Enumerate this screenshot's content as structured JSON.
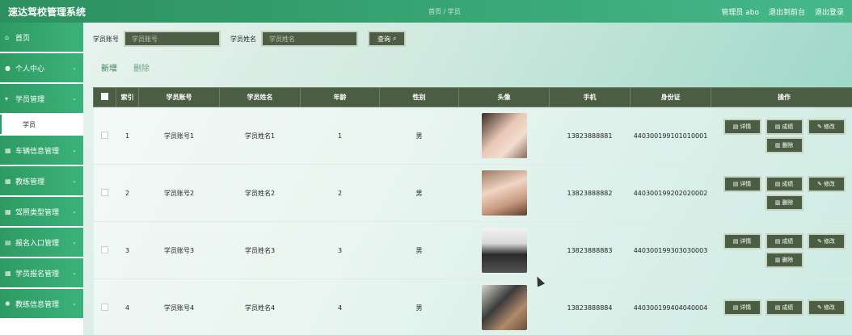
{
  "header": {
    "app_title": "速达驾校管理系统",
    "breadcrumb": "首页 / 学员",
    "admin_label": "管理员 abo",
    "to_front": "退出到前台",
    "logout": "退出登录"
  },
  "sidebar": {
    "items": [
      {
        "label": "首页",
        "icon": "home-icon"
      },
      {
        "label": "个人中心",
        "icon": "user-icon"
      },
      {
        "label": "学员管理",
        "icon": "user-list-icon"
      },
      {
        "label": "车辆信息管理",
        "icon": "grid-icon"
      },
      {
        "label": "教练管理",
        "icon": "grid-icon"
      },
      {
        "label": "驾照类型管理",
        "icon": "grid-icon"
      },
      {
        "label": "报名入口管理",
        "icon": "doc-icon"
      },
      {
        "label": "学员报名管理",
        "icon": "grid-icon"
      },
      {
        "label": "教练信息管理",
        "icon": "gear-icon"
      }
    ],
    "sub_item": "学员"
  },
  "search": {
    "account_label": "学员账号",
    "account_placeholder": "学员账号",
    "name_label": "学员姓名",
    "name_placeholder": "学员姓名",
    "query_button": "查询"
  },
  "actions": {
    "add": "新增",
    "delete": "删除"
  },
  "table": {
    "headers": [
      "",
      "索引",
      "学员账号",
      "学员姓名",
      "年龄",
      "性别",
      "头像",
      "手机",
      "身份证",
      "操作"
    ],
    "rows": [
      {
        "index": "1",
        "account": "学员账号1",
        "name": "学员姓名1",
        "age": "1",
        "gender": "男",
        "phone": "13823888881",
        "id_card": "440300199101010001"
      },
      {
        "index": "2",
        "account": "学员账号2",
        "name": "学员姓名2",
        "age": "2",
        "gender": "男",
        "phone": "13823888882",
        "id_card": "440300199202020002"
      },
      {
        "index": "3",
        "account": "学员账号3",
        "name": "学员姓名3",
        "age": "3",
        "gender": "男",
        "phone": "13823888883",
        "id_card": "440300199303030003"
      },
      {
        "index": "4",
        "account": "学员账号4",
        "name": "学员姓名4",
        "age": "4",
        "gender": "男",
        "phone": "13823888884",
        "id_card": "440300199404040004"
      }
    ],
    "op_labels": {
      "detail": "详情",
      "score": "成绩",
      "edit": "修改",
      "remove": "删除"
    }
  },
  "colors": {
    "brand_green": "#2e9a63",
    "dark_olive": "#4b5e44",
    "accent_teal": "#8fd3c0"
  }
}
